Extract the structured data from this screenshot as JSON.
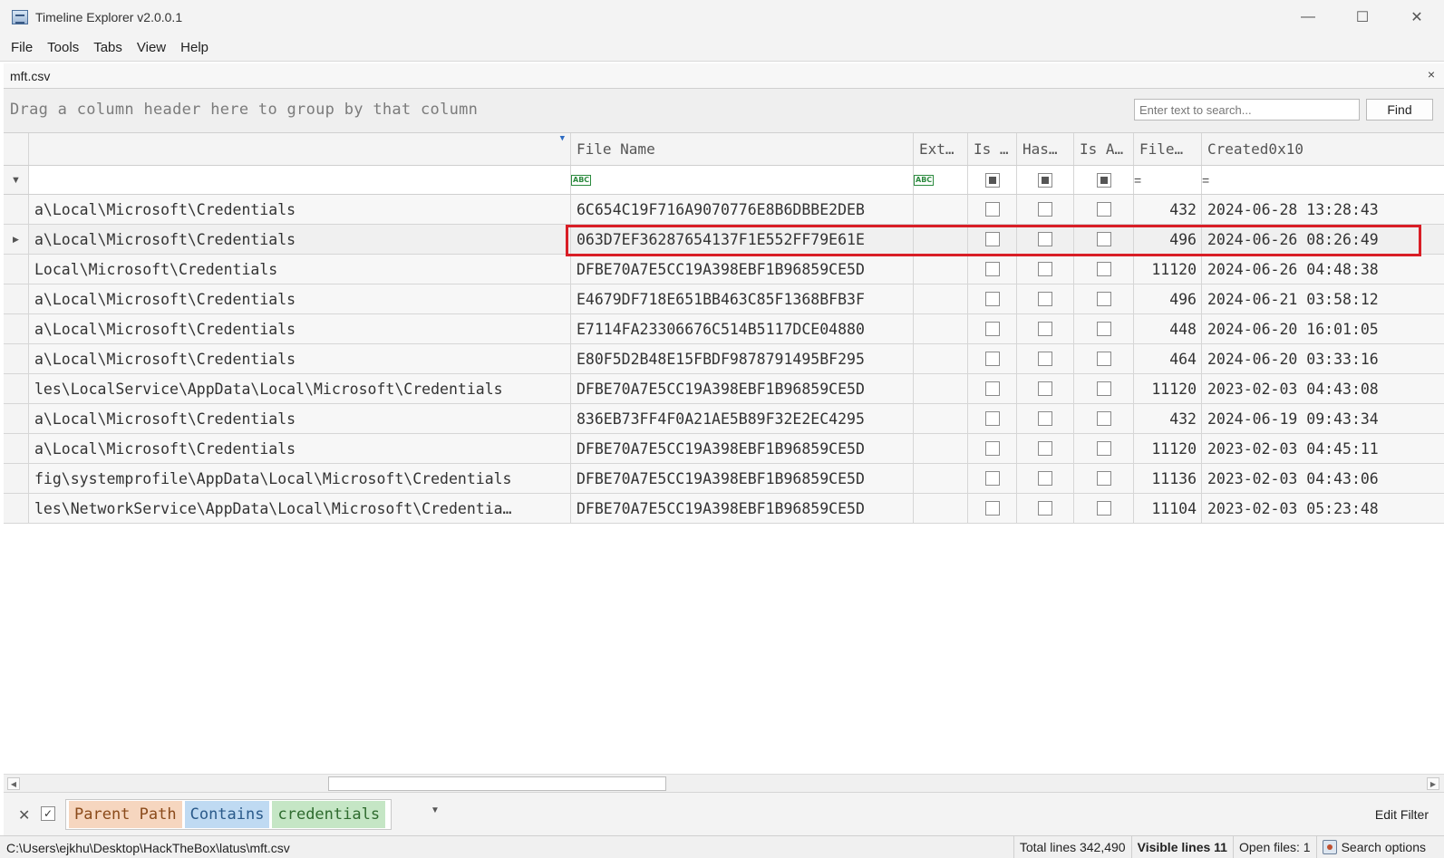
{
  "window": {
    "title": "Timeline Explorer v2.0.0.1",
    "minimize_glyph": "—",
    "maximize_glyph": "☐",
    "close_glyph": "✕"
  },
  "menu": [
    "File",
    "Tools",
    "Tabs",
    "View",
    "Help"
  ],
  "tab": {
    "label": "mft.csv",
    "close_glyph": "×"
  },
  "group_panel": {
    "hint": "Drag a column header here to group by that column",
    "search_placeholder": "Enter text to search...",
    "search_value": "",
    "find_label": "Find"
  },
  "grid": {
    "columns": {
      "parent_path": "",
      "file_name": "File Name",
      "extension": "Ext…",
      "is_directory": "Is …",
      "has_ads": "Has…",
      "is_ads": "Is A…",
      "file_size": "File…",
      "created": "Created0x10"
    },
    "filter_icons": {
      "text": "ABC",
      "equals": "="
    },
    "rows": [
      {
        "path": "a\\Local\\Microsoft\\Credentials",
        "file": "6C654C19F716A9070776E8B6DBBE2DEB",
        "size": "432",
        "created": "2024-06-28 13:28:43"
      },
      {
        "path": "a\\Local\\Microsoft\\Credentials",
        "file": "063D7EF36287654137F1E552FF79E61E",
        "size": "496",
        "created": "2024-06-26 08:26:49"
      },
      {
        "path": "Local\\Microsoft\\Credentials",
        "file": "DFBE70A7E5CC19A398EBF1B96859CE5D",
        "size": "11120",
        "created": "2024-06-26 04:48:38"
      },
      {
        "path": "a\\Local\\Microsoft\\Credentials",
        "file": "E4679DF718E651BB463C85F1368BFB3F",
        "size": "496",
        "created": "2024-06-21 03:58:12"
      },
      {
        "path": "a\\Local\\Microsoft\\Credentials",
        "file": "E7114FA23306676C514B5117DCE04880",
        "size": "448",
        "created": "2024-06-20 16:01:05"
      },
      {
        "path": "a\\Local\\Microsoft\\Credentials",
        "file": "E80F5D2B48E15FBDF9878791495BF295",
        "size": "464",
        "created": "2024-06-20 03:33:16"
      },
      {
        "path": "les\\LocalService\\AppData\\Local\\Microsoft\\Credentials",
        "file": "DFBE70A7E5CC19A398EBF1B96859CE5D",
        "size": "11120",
        "created": "2023-02-03 04:43:08"
      },
      {
        "path": "a\\Local\\Microsoft\\Credentials",
        "file": "836EB73FF4F0A21AE5B89F32E2EC4295",
        "size": "432",
        "created": "2024-06-19 09:43:34"
      },
      {
        "path": "a\\Local\\Microsoft\\Credentials",
        "file": "DFBE70A7E5CC19A398EBF1B96859CE5D",
        "size": "11120",
        "created": "2023-02-03 04:45:11"
      },
      {
        "path": "fig\\systemprofile\\AppData\\Local\\Microsoft\\Credentials",
        "file": "DFBE70A7E5CC19A398EBF1B96859CE5D",
        "size": "11136",
        "created": "2023-02-03 04:43:06"
      },
      {
        "path": "les\\NetworkService\\AppData\\Local\\Microsoft\\Credentia…",
        "file": "DFBE70A7E5CC19A398EBF1B96859CE5D",
        "size": "11104",
        "created": "2023-02-03 05:23:48"
      }
    ],
    "selected_row": 1
  },
  "filter_bar": {
    "field": "Parent Path",
    "operator": "Contains",
    "value": "credentials",
    "edit_label": "Edit Filter"
  },
  "status": {
    "path": "C:\\Users\\ejkhu\\Desktop\\HackTheBox\\latus\\mft.csv",
    "total_lines": "Total lines 342,490",
    "visible_lines": "Visible lines 11",
    "open_files": "Open files: 1",
    "search_options": "Search options"
  },
  "colors": {
    "highlight_border": "#d91e26",
    "field_token": "#f6d6bf",
    "operator_token": "#bfdaf2",
    "value_token": "#c5e6c5"
  }
}
